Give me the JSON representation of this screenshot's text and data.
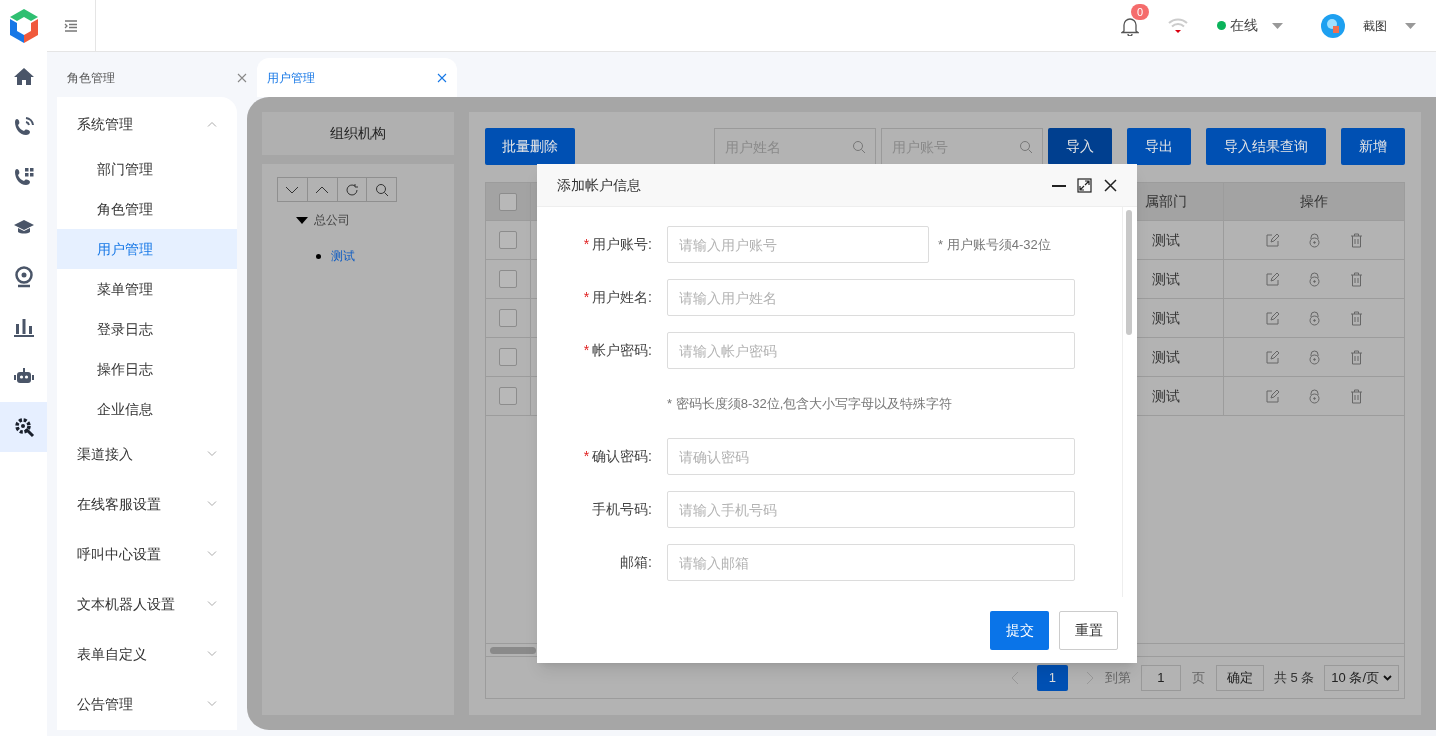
{
  "header": {
    "notification_count": "0",
    "status": "在线",
    "user_name": "截图"
  },
  "rail_items": [
    {
      "selected": false
    },
    {
      "selected": false
    },
    {
      "selected": false
    },
    {
      "selected": false
    },
    {
      "selected": false
    },
    {
      "selected": false
    },
    {
      "selected": false
    },
    {
      "selected": true
    }
  ],
  "tabs": [
    {
      "label": "角色管理",
      "selected": false
    },
    {
      "label": "用户管理",
      "selected": true
    }
  ],
  "menu": [
    {
      "label": "系统管理",
      "expanded": true,
      "children": [
        {
          "label": "部门管理",
          "selected": false
        },
        {
          "label": "角色管理",
          "selected": false
        },
        {
          "label": "用户管理",
          "selected": true
        },
        {
          "label": "菜单管理",
          "selected": false
        },
        {
          "label": "登录日志",
          "selected": false
        },
        {
          "label": "操作日志",
          "selected": false
        },
        {
          "label": "企业信息",
          "selected": false
        }
      ]
    },
    {
      "label": "渠道接入",
      "expanded": false
    },
    {
      "label": "在线客服设置",
      "expanded": false
    },
    {
      "label": "呼叫中心设置",
      "expanded": false
    },
    {
      "label": "文本机器人设置",
      "expanded": false
    },
    {
      "label": "表单自定义",
      "expanded": false
    },
    {
      "label": "公告管理",
      "expanded": false
    }
  ],
  "org_panel": {
    "title": "组织机构",
    "tree": [
      {
        "label": "总公司",
        "expanded": true,
        "children": [
          {
            "label": "测试",
            "selected": true
          }
        ]
      }
    ]
  },
  "toolbar": {
    "batch_delete": "批量删除",
    "search_fields": [
      {
        "placeholder": "用户姓名"
      },
      {
        "placeholder": "用户账号"
      }
    ],
    "buttons": [
      {
        "label": "导入",
        "focused": true
      },
      {
        "label": "导出",
        "focused": false
      },
      {
        "label": "导入结果查询",
        "focused": false
      },
      {
        "label": "新增",
        "focused": false
      }
    ]
  },
  "table": {
    "header_checked": false,
    "columns": [
      {
        "kind": "checkbox"
      },
      {
        "kind": "text",
        "label": "属部门"
      },
      {
        "kind": "actions",
        "label": "操作"
      }
    ],
    "rows": [
      {
        "checked": false,
        "dept": "测试"
      },
      {
        "checked": false,
        "dept": "测试"
      },
      {
        "checked": false,
        "dept": "测试"
      },
      {
        "checked": false,
        "dept": "测试"
      },
      {
        "checked": false,
        "dept": "测试"
      }
    ]
  },
  "pagination": {
    "pages": [
      {
        "label": "1",
        "selected": true
      }
    ],
    "goto_label": "到第",
    "goto_value": "1",
    "page_unit": "页",
    "confirm": "确定",
    "total": "共 5 条",
    "page_size": "10 条/页"
  },
  "dialog": {
    "title": "添加帐户信息",
    "required_mark": "*",
    "rows": [
      {
        "kind": "field",
        "label": "用户账号:",
        "required": true,
        "placeholder": "请输入用户账号",
        "hint": "* 用户账号须4-32位"
      },
      {
        "kind": "field",
        "label": "用户姓名:",
        "required": true,
        "placeholder": "请输入用户姓名"
      },
      {
        "kind": "field",
        "label": "帐户密码:",
        "required": true,
        "placeholder": "请输入帐户密码"
      },
      {
        "kind": "note",
        "text": "* 密码长度须8-32位,包含大小写字母以及特殊字符"
      },
      {
        "kind": "field",
        "label": "确认密码:",
        "required": true,
        "placeholder": "请确认密码"
      },
      {
        "kind": "field",
        "label": "手机号码:",
        "required": false,
        "placeholder": "请输入手机号码"
      },
      {
        "kind": "field",
        "label": "邮箱:",
        "required": false,
        "placeholder": "请输入邮箱"
      }
    ],
    "buttons": [
      {
        "label": "提交",
        "primary": true
      },
      {
        "label": "重置",
        "primary": false
      }
    ]
  }
}
